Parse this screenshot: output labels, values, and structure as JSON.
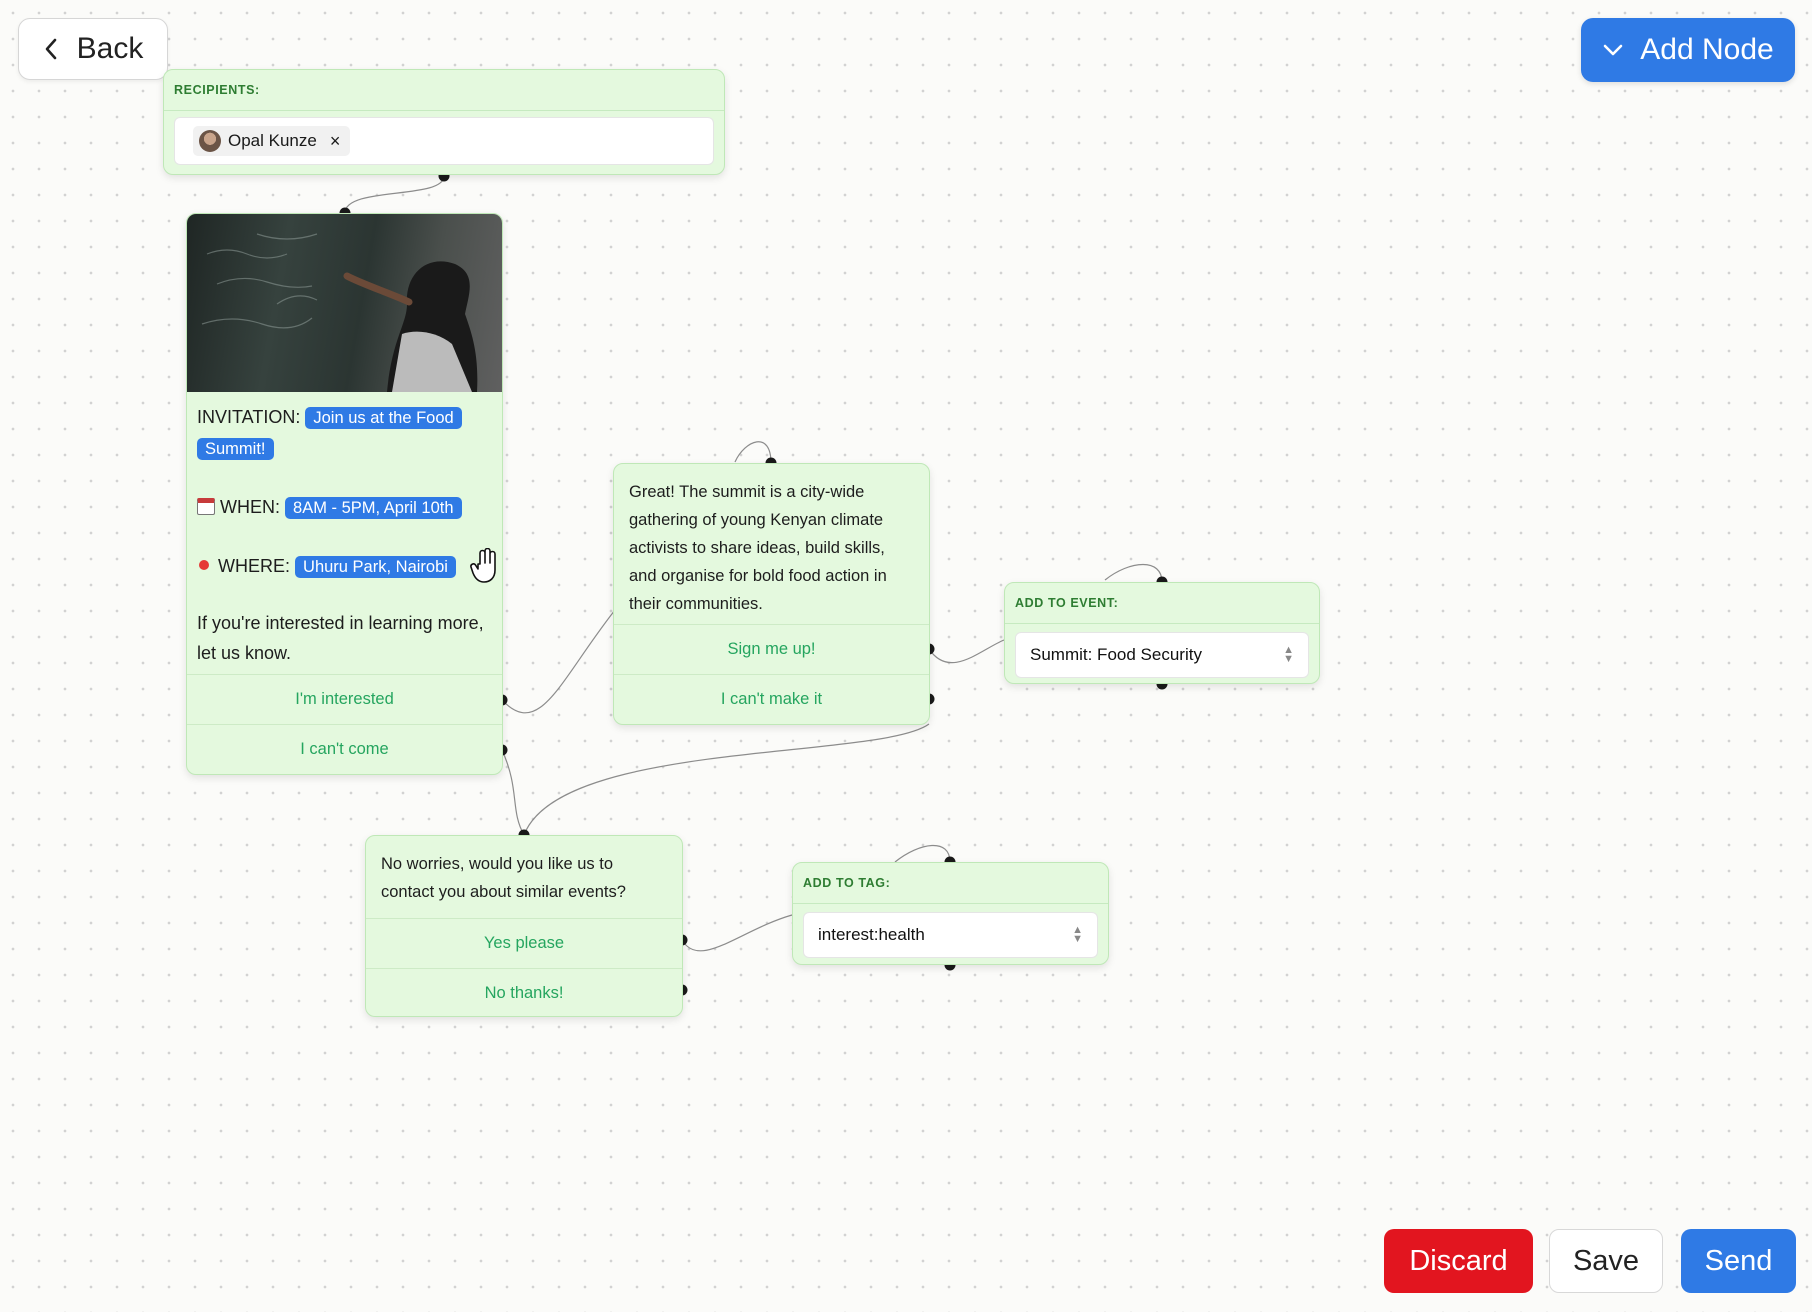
{
  "toolbar": {
    "back_label": "Back",
    "add_node_label": "Add Node",
    "discard_label": "Discard",
    "save_label": "Save",
    "send_label": "Send"
  },
  "colors": {
    "accent": "#2f7ae5",
    "danger": "#e2151f",
    "node_bg": "#e4f9de",
    "option_text": "#25a55f"
  },
  "recipients_node": {
    "header": "RECIPIENTS:",
    "recipient_name": "Opal Kunze",
    "remove_icon": "×"
  },
  "invitation_node": {
    "image_alt": "girl writing on chalkboard",
    "invitation_label": "INVITATION:",
    "invitation_value": "Join us at the Food Summit!",
    "when_icon": "calendar-icon",
    "when_label": "WHEN:",
    "when_value": "8AM - 5PM, April 10th",
    "where_icon": "pin-icon",
    "where_label": "WHERE:",
    "where_value": "Uhuru Park, Nairobi",
    "body": "If you're interested in learning more, let us know.",
    "options": [
      "I'm interested",
      "I can't come"
    ]
  },
  "summit_node": {
    "body": "Great! The summit is a city-wide gathering of young Kenyan climate activists to share ideas, build skills, and organise for bold food action in their communities.",
    "options": [
      "Sign me up!",
      "I can't make it"
    ]
  },
  "event_node": {
    "header": "ADD TO EVENT:",
    "value": "Summit: Food Security"
  },
  "followup_node": {
    "body": "No worries, would you like us to contact you about similar events?",
    "options": [
      "Yes please",
      "No thanks!"
    ]
  },
  "tag_node": {
    "header": "ADD TO TAG:",
    "value": "interest:health"
  }
}
